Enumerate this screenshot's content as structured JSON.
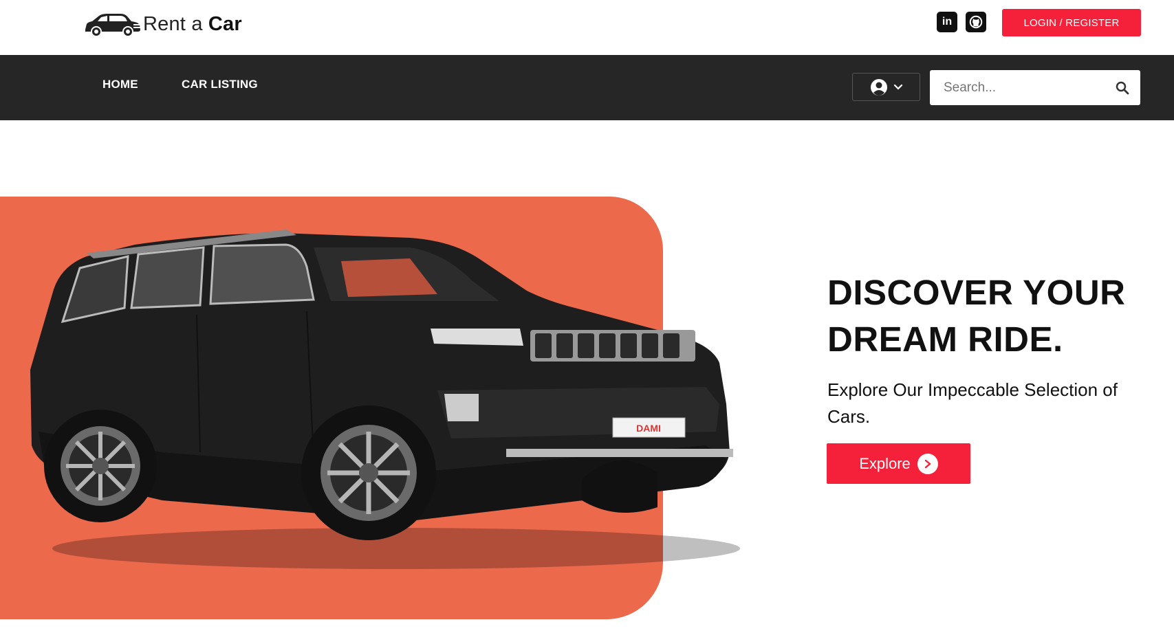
{
  "brand": {
    "name_light": "Rent a ",
    "name_bold": "Car"
  },
  "header": {
    "social": [
      {
        "icon": "linkedin-icon",
        "glyph": "in"
      },
      {
        "icon": "github-icon"
      }
    ],
    "login_label": "LOGIN / REGISTER"
  },
  "nav": {
    "items": [
      {
        "label": "HOME"
      },
      {
        "label": "CAR LISTING"
      }
    ],
    "user_menu_icon": "user-circle-icon",
    "search": {
      "placeholder": "Search...",
      "value": ""
    }
  },
  "hero": {
    "title": "DISCOVER YOUR DREAM RIDE.",
    "subtitle": "Explore Our Impeccable Selection of Cars.",
    "cta_label": "Explore",
    "plate_text": "DAMI"
  },
  "colors": {
    "accent": "#f5213a",
    "nav_bg": "#262626",
    "hero_panel": "#ec694c"
  }
}
